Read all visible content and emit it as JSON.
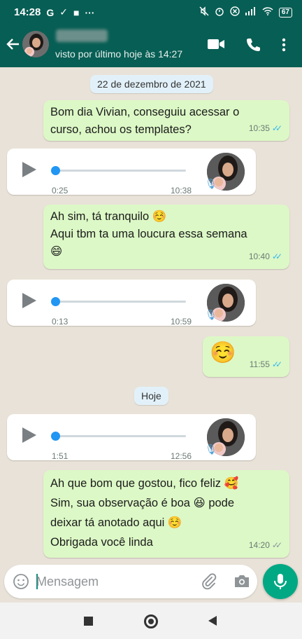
{
  "status_bar": {
    "time": "14:28",
    "left_icons": [
      "google-icon",
      "verified-icon",
      "bag-icon",
      "more-dots-icon"
    ],
    "right_icons": [
      "mute-icon",
      "alarm-icon",
      "close-circle-icon",
      "signal-icon",
      "wifi-icon"
    ],
    "battery": "67"
  },
  "header": {
    "last_seen": "visto por último hoje às 14:27",
    "icons": [
      "back-arrow-icon",
      "video-call-icon",
      "phone-icon",
      "kebab-menu-icon"
    ]
  },
  "chat": {
    "date_chips": [
      "22 de dezembro de 2021",
      "Hoje"
    ],
    "messages": [
      {
        "type": "text",
        "direction": "out",
        "text": "Bom dia Vivian, conseguiu acessar o\ncurso, achou os templates?",
        "time": "10:35",
        "status": "read"
      },
      {
        "type": "voice",
        "direction": "in",
        "duration": "0:25",
        "time": "10:38"
      },
      {
        "type": "text",
        "direction": "out",
        "text": "Ah sim, tá tranquilo ☺️\nAqui tbm ta uma loucura essa semana\n😄",
        "time": "10:40",
        "status": "read"
      },
      {
        "type": "voice",
        "direction": "in",
        "duration": "0:13",
        "time": "10:59"
      },
      {
        "type": "text",
        "direction": "out",
        "text": "☺️",
        "time": "11:55",
        "status": "read"
      },
      {
        "type": "voice",
        "direction": "in",
        "duration": "1:51",
        "time": "12:56"
      },
      {
        "type": "text",
        "direction": "out",
        "text": "Ah que bom que gostou, fico feliz 🥰\nSim, sua observação é boa 😆 pode\ndeixar tá anotado aqui ☺️\nObrigada você linda",
        "time": "14:20",
        "status": "delivered"
      }
    ]
  },
  "composer": {
    "placeholder": "Mensagem",
    "icons": [
      "emoji-icon",
      "attach-icon",
      "camera-icon",
      "mic-icon"
    ]
  },
  "colors": {
    "header": "#075e54",
    "outgoing_bubble": "#dcf8c6",
    "incoming_bubble": "#ffffff",
    "read_ticks": "#34b7f1",
    "fab": "#00a884",
    "voice_dot": "#2196f3"
  }
}
